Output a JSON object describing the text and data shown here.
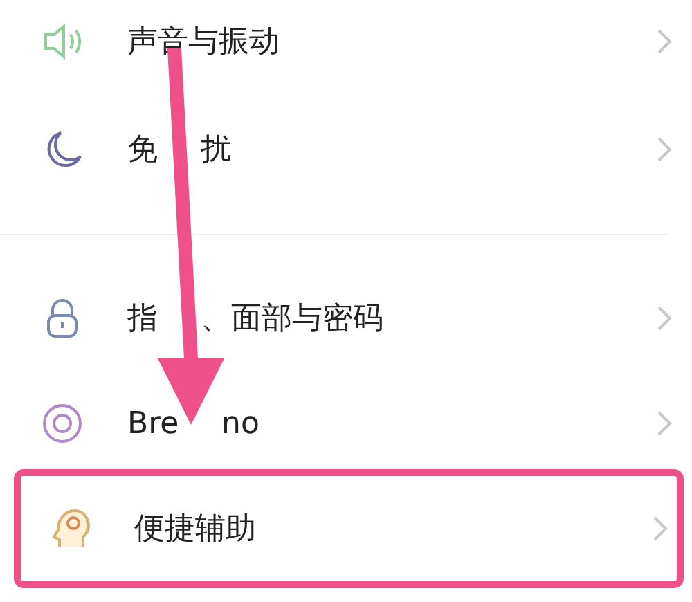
{
  "groups": [
    {
      "items": [
        {
          "label_parts": [
            "声音与振动"
          ],
          "highlighted": false
        },
        {
          "label_parts": [
            "免",
            "扰"
          ],
          "highlighted": false
        }
      ]
    },
    {
      "items": [
        {
          "label_parts": [
            "指",
            "、面部与密码"
          ],
          "highlighted": false
        },
        {
          "label_parts": [
            "Bre",
            "no"
          ],
          "highlighted": false
        },
        {
          "label_parts": [
            "便捷辅助"
          ],
          "highlighted": true
        }
      ]
    }
  ]
}
